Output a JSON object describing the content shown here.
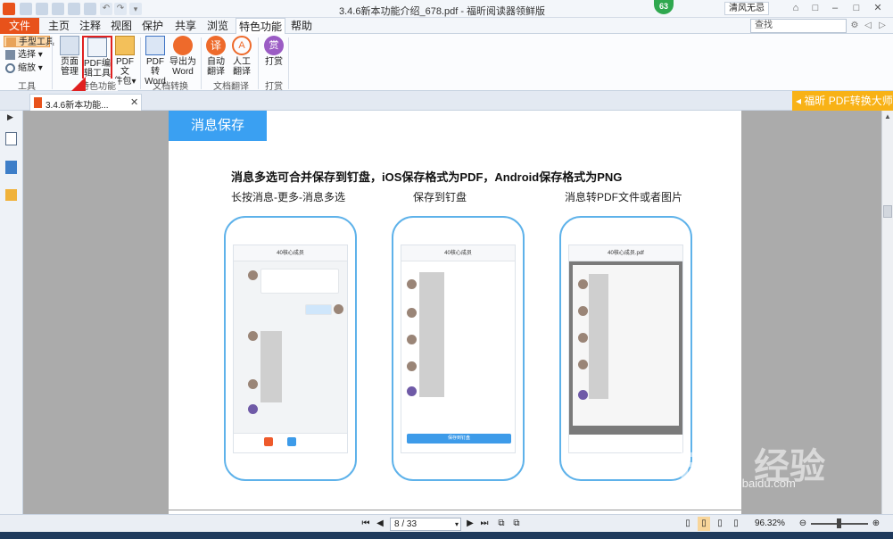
{
  "window": {
    "title": "3.4.6新本功能介绍_678.pdf - 福昕阅读器领鲜版",
    "badge": "63",
    "user": "清风无忌",
    "search_placeholder": "查找"
  },
  "menu": [
    "文件",
    "主页",
    "注释",
    "视图",
    "保护",
    "共享",
    "浏览",
    "特色功能",
    "帮助"
  ],
  "ribbon": {
    "tools": {
      "hand": "手型工具",
      "select": "选择",
      "zoom": "缩放",
      "label": "工具"
    },
    "special": {
      "page_manage": [
        "页面",
        "管理"
      ],
      "pdf_edit": [
        "PDF编",
        "辑工具"
      ],
      "pdf_package": [
        "PDF文",
        "件包"
      ],
      "label": "特色功能"
    },
    "convert": {
      "to_word": [
        "PDF转",
        "Word"
      ],
      "export_word": [
        "导出为",
        "Word"
      ],
      "label": "文档转换"
    },
    "translate": {
      "auto": [
        "自动",
        "翻译"
      ],
      "manual": [
        "人工",
        "翻译"
      ],
      "label": "文档翻译"
    },
    "reward": {
      "btn": "打赏",
      "label": "打赏"
    }
  },
  "tab": {
    "title": "3.4.6新本功能..."
  },
  "promo": "福昕 PDF转换大师",
  "page": {
    "header": "消息保存",
    "heading": "消息多选可合并保存到钉盘，iOS保存格式为PDF，Android保存格式为PNG",
    "captions": [
      "长按消息-更多-消息多选",
      "保存到钉盘",
      "消息转PDF文件或者图片"
    ],
    "phone_titles": [
      "40核心成员",
      "40核心成员",
      "40核心成员.pdf"
    ],
    "save_button": "保存到钉盘"
  },
  "status": {
    "page": "8 / 33",
    "zoom": "96.32%"
  },
  "watermark": {
    "brand": "Bai  经验",
    "url": "jingyan.baidu.com"
  },
  "colors": {
    "accent": "#e8521b",
    "header_blue": "#3aa0f2",
    "promo": "#f8b216",
    "highlight": "#e02020"
  }
}
